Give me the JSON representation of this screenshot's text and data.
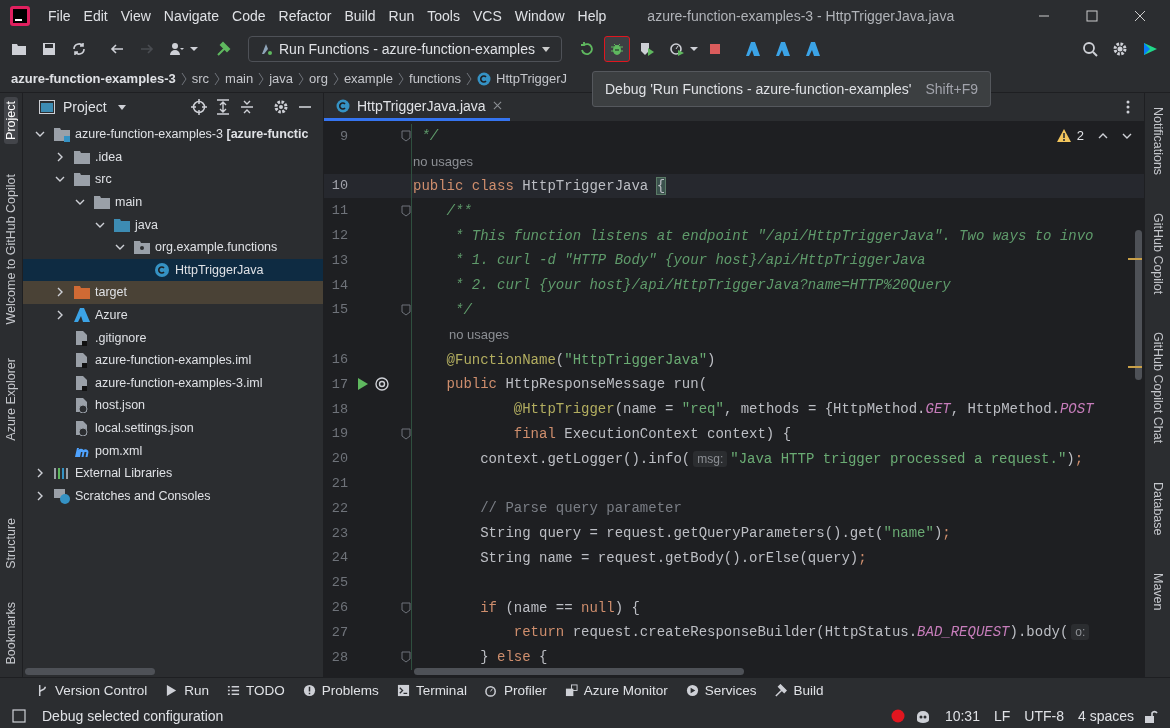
{
  "window": {
    "title": "azure-function-examples-3 - HttpTriggerJava.java"
  },
  "menu": [
    "File",
    "Edit",
    "View",
    "Navigate",
    "Code",
    "Refactor",
    "Build",
    "Run",
    "Tools",
    "VCS",
    "Window",
    "Help"
  ],
  "toolbar": [
    {
      "kind": "folder",
      "hovered": false,
      "disabled": false
    },
    {
      "kind": "save",
      "hovered": false,
      "disabled": false
    },
    {
      "kind": "sync",
      "hovered": false,
      "disabled": false
    },
    {
      "kind": "back",
      "hovered": false,
      "disabled": false
    },
    {
      "kind": "forward",
      "hovered": false,
      "disabled": true
    },
    {
      "kind": "user",
      "hovered": false,
      "disabled": false
    },
    {
      "kind": "hammer",
      "hovered": false,
      "disabled": false
    },
    {
      "kind": "config",
      "label": "Run Functions - azure-function-examples",
      "hovered": false,
      "disabled": false
    },
    {
      "kind": "rerun",
      "hovered": false,
      "disabled": false
    },
    {
      "kind": "debug",
      "hovered": true,
      "disabled": false
    },
    {
      "kind": "coverage",
      "hovered": false,
      "disabled": false
    },
    {
      "kind": "profile",
      "hovered": false,
      "disabled": false
    },
    {
      "kind": "stop",
      "hovered": false,
      "disabled": false
    },
    {
      "kind": "azure",
      "hovered": false,
      "disabled": false
    },
    {
      "kind": "azure",
      "hovered": false,
      "disabled": false
    },
    {
      "kind": "azure",
      "hovered": false,
      "disabled": false
    }
  ],
  "breadcrumbs": [
    "azure-function-examples-3",
    "src",
    "main",
    "java",
    "org",
    "example",
    "functions",
    "HttpTriggerJ"
  ],
  "tooltip": {
    "text": "Debug 'Run Functions - azure-function-examples'",
    "shortcut": "Shift+F9"
  },
  "left_stripe": [
    {
      "label": "Project",
      "selected": true
    },
    {
      "label": "Welcome to GitHub Copilot",
      "selected": false
    },
    {
      "label": "Azure Explorer",
      "selected": false
    },
    {
      "label": "Structure",
      "selected": false
    },
    {
      "label": "Bookmarks",
      "selected": false
    }
  ],
  "right_stripe": [
    "Notifications",
    "GitHub Copilot",
    "GitHub Copilot Chat",
    "Database",
    "Maven"
  ],
  "project": {
    "title": "Project",
    "tree": [
      {
        "label": "azure-function-examples-3 **[azure-functic**",
        "kind": "module",
        "expanded": true,
        "selected": false,
        "children": [
          {
            "label": ".idea",
            "kind": "folder",
            "expanded": false,
            "selected": false
          },
          {
            "label": "src",
            "kind": "folder",
            "expanded": true,
            "selected": false,
            "children": [
              {
                "label": "main",
                "kind": "folder",
                "expanded": true,
                "selected": false,
                "children": [
                  {
                    "label": "java",
                    "kind": "source-folder",
                    "expanded": true,
                    "selected": false,
                    "children": [
                      {
                        "label": "org.example.functions",
                        "kind": "package",
                        "expanded": true,
                        "selected": false,
                        "children": [
                          {
                            "label": "HttpTriggerJava",
                            "kind": "class",
                            "selected": true
                          }
                        ]
                      }
                    ]
                  }
                ]
              }
            ]
          },
          {
            "label": "target",
            "kind": "excluded-folder",
            "expanded": false,
            "selected": false
          },
          {
            "label": "Azure",
            "kind": "azure",
            "expanded": false,
            "selected": false
          },
          {
            "label": ".gitignore",
            "kind": "file",
            "selected": false
          },
          {
            "label": "azure-function-examples.iml",
            "kind": "file",
            "selected": false
          },
          {
            "label": "azure-function-examples-3.iml",
            "kind": "file",
            "selected": false
          },
          {
            "label": "host.json",
            "kind": "json",
            "selected": false
          },
          {
            "label": "local.settings.json",
            "kind": "json",
            "selected": false
          },
          {
            "label": "pom.xml",
            "kind": "maven",
            "selected": false
          }
        ]
      },
      {
        "label": "External Libraries",
        "kind": "libraries",
        "expanded": false,
        "selected": false
      },
      {
        "label": "Scratches and Consoles",
        "kind": "scratches",
        "expanded": false,
        "selected": false
      }
    ]
  },
  "editor": {
    "tabs": [
      {
        "label": "HttpTriggerJava.java",
        "selected": true
      }
    ],
    "warnings": "2",
    "lines": [
      {
        "kind": "code",
        "number": "9",
        "current": false,
        "fold": true,
        "run": false,
        "tokens": [
          {
            "kind": "doc",
            "text": " */"
          }
        ]
      },
      {
        "kind": "hint",
        "text": "no usages"
      },
      {
        "kind": "code",
        "number": "10",
        "current": true,
        "fold": false,
        "run": false,
        "tokens": [
          {
            "kind": "keyword",
            "text": "public class "
          },
          {
            "kind": "plain",
            "text": "HttpTriggerJava "
          },
          {
            "kind": "brace",
            "text": "{"
          }
        ]
      },
      {
        "kind": "code",
        "number": "11",
        "current": false,
        "fold": true,
        "run": false,
        "tokens": [
          {
            "kind": "doc",
            "text": "    /**"
          }
        ]
      },
      {
        "kind": "code",
        "number": "12",
        "current": false,
        "fold": false,
        "run": false,
        "tokens": [
          {
            "kind": "doc",
            "text": "     * This function listens at endpoint \"/api/HttpTriggerJava\". Two ways to invo"
          }
        ]
      },
      {
        "kind": "code",
        "number": "13",
        "current": false,
        "fold": false,
        "run": false,
        "tokens": [
          {
            "kind": "doc",
            "text": "     * 1. curl -d \"HTTP Body\" {your host}/api/HttpTriggerJava"
          }
        ]
      },
      {
        "kind": "code",
        "number": "14",
        "current": false,
        "fold": false,
        "run": false,
        "tokens": [
          {
            "kind": "doc",
            "text": "     * 2. curl {your host}/api/HttpTriggerJava?name=HTTP%20Query"
          }
        ]
      },
      {
        "kind": "code",
        "number": "15",
        "current": false,
        "fold": true,
        "run": false,
        "tokens": [
          {
            "kind": "doc",
            "text": "     */"
          }
        ]
      },
      {
        "kind": "hint",
        "text": "no usages"
      },
      {
        "kind": "code",
        "number": "16",
        "current": false,
        "fold": false,
        "run": false,
        "tokens": [
          {
            "kind": "annotation",
            "text": "    @FunctionName"
          },
          {
            "kind": "plain",
            "text": "("
          },
          {
            "kind": "string",
            "text": "\"HttpTriggerJava\""
          },
          {
            "kind": "plain",
            "text": ")"
          }
        ]
      },
      {
        "kind": "code",
        "number": "17",
        "current": false,
        "fold": false,
        "run": true,
        "tokens": [
          {
            "kind": "keyword",
            "text": "    public "
          },
          {
            "kind": "plain",
            "text": "HttpResponseMessage run("
          }
        ]
      },
      {
        "kind": "code",
        "number": "18",
        "current": false,
        "fold": false,
        "run": false,
        "tokens": [
          {
            "kind": "annotation",
            "text": "            @HttpTrigger"
          },
          {
            "kind": "plain",
            "text": "(name = "
          },
          {
            "kind": "string",
            "text": "\"req\""
          },
          {
            "kind": "plain",
            "text": ", methods = {HttpMethod."
          },
          {
            "kind": "constant",
            "text": "GET"
          },
          {
            "kind": "plain",
            "text": ", HttpMethod."
          },
          {
            "kind": "constant",
            "text": "POST"
          }
        ]
      },
      {
        "kind": "code",
        "number": "19",
        "current": false,
        "fold": true,
        "run": false,
        "tokens": [
          {
            "kind": "keyword",
            "text": "            final "
          },
          {
            "kind": "plain",
            "text": "ExecutionContext context) {"
          }
        ]
      },
      {
        "kind": "code",
        "number": "20",
        "current": false,
        "fold": false,
        "run": false,
        "tokens": [
          {
            "kind": "plain",
            "text": "        context.getLogger().info("
          },
          {
            "kind": "hint",
            "text": "msg:"
          },
          {
            "kind": "string",
            "text": "\"Java HTTP trigger processed a request.\""
          },
          {
            "kind": "plain",
            "text": ")"
          },
          {
            "kind": "keyword",
            "text": ";"
          }
        ]
      },
      {
        "kind": "code",
        "number": "21",
        "current": false,
        "fold": false,
        "run": false
      },
      {
        "kind": "code",
        "number": "22",
        "current": false,
        "fold": false,
        "run": false,
        "tokens": [
          {
            "kind": "comment",
            "text": "        // Parse query parameter"
          }
        ]
      },
      {
        "kind": "code",
        "number": "23",
        "current": false,
        "fold": false,
        "run": false,
        "tokens": [
          {
            "kind": "plain",
            "text": "        String query = request.getQueryParameters().get("
          },
          {
            "kind": "string",
            "text": "\"name\""
          },
          {
            "kind": "plain",
            "text": ")"
          },
          {
            "kind": "keyword",
            "text": ";"
          }
        ]
      },
      {
        "kind": "code",
        "number": "24",
        "current": false,
        "fold": false,
        "run": false,
        "tokens": [
          {
            "kind": "plain",
            "text": "        String name = request.getBody().orElse(query)"
          },
          {
            "kind": "keyword",
            "text": ";"
          }
        ]
      },
      {
        "kind": "code",
        "number": "25",
        "current": false,
        "fold": false,
        "run": false
      },
      {
        "kind": "code",
        "number": "26",
        "current": false,
        "fold": true,
        "run": false,
        "tokens": [
          {
            "kind": "keyword",
            "text": "        if "
          },
          {
            "kind": "plain",
            "text": "(name == "
          },
          {
            "kind": "keyword",
            "text": "null"
          },
          {
            "kind": "plain",
            "text": ") {"
          }
        ]
      },
      {
        "kind": "code",
        "number": "27",
        "current": false,
        "fold": false,
        "run": false,
        "tokens": [
          {
            "kind": "keyword",
            "text": "            return "
          },
          {
            "kind": "plain",
            "text": "request.createResponseBuilder(HttpStatus."
          },
          {
            "kind": "constant",
            "text": "BAD_REQUEST"
          },
          {
            "kind": "plain",
            "text": ").body("
          },
          {
            "kind": "hint",
            "text": "o:"
          }
        ]
      },
      {
        "kind": "code",
        "number": "28",
        "current": false,
        "fold": true,
        "run": false,
        "tokens": [
          {
            "kind": "plain",
            "text": "        } "
          },
          {
            "kind": "keyword",
            "text": "else "
          },
          {
            "kind": "plain",
            "text": "{"
          }
        ]
      }
    ]
  },
  "tool_windows": [
    {
      "kind": "vcs",
      "label": "Version Control"
    },
    {
      "kind": "run",
      "label": "Run"
    },
    {
      "kind": "todo",
      "label": "TODO"
    },
    {
      "kind": "problems",
      "label": "Problems"
    },
    {
      "kind": "terminal",
      "label": "Terminal"
    },
    {
      "kind": "profiler",
      "label": "Profiler"
    },
    {
      "kind": "monitor",
      "label": "Azure Monitor"
    },
    {
      "kind": "services",
      "label": "Services"
    },
    {
      "kind": "build",
      "label": "Build"
    }
  ],
  "status_bar": {
    "message": "Debug selected configuration",
    "position": "10:31",
    "line_separator": "LF",
    "encoding": "UTF-8",
    "indent": "4 spaces"
  }
}
